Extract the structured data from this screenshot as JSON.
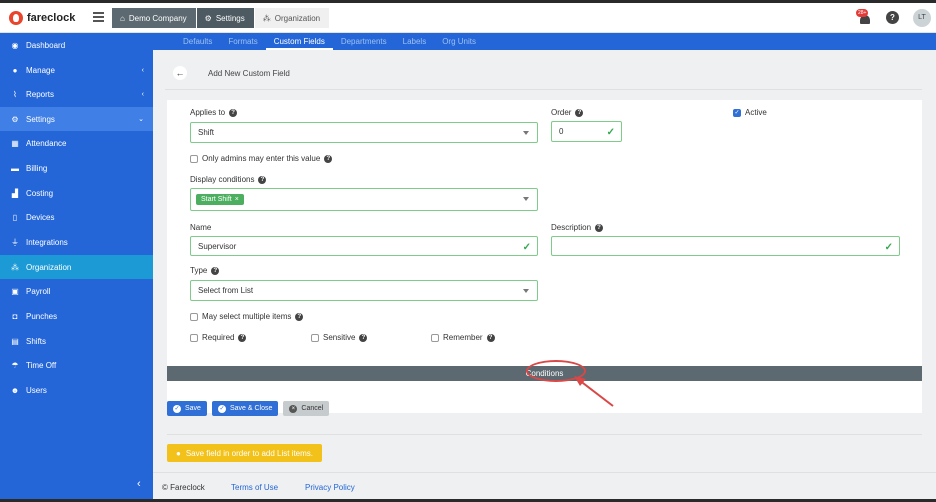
{
  "app": {
    "brand": "fareclock"
  },
  "breadcrumbs": [
    {
      "label": "Demo Company",
      "icon": "home-icon"
    },
    {
      "label": "Settings",
      "icon": "gear-icon"
    },
    {
      "label": "Organization",
      "icon": "org-chart-icon"
    }
  ],
  "header": {
    "notification_count": "28+",
    "help": "?",
    "avatar_initials": "LT"
  },
  "sidebar": {
    "items": [
      {
        "label": "Dashboard",
        "icon": "dashboard-icon"
      },
      {
        "label": "Manage",
        "icon": "user-icon",
        "chevron": "‹"
      },
      {
        "label": "Reports",
        "icon": "chart-icon",
        "chevron": "‹"
      },
      {
        "label": "Settings",
        "icon": "gear-icon",
        "chevron": "⌄"
      },
      {
        "label": "Attendance",
        "icon": "calendar-icon"
      },
      {
        "label": "Billing",
        "icon": "credit-card-icon"
      },
      {
        "label": "Costing",
        "icon": "bar-chart-icon"
      },
      {
        "label": "Devices",
        "icon": "tablet-icon"
      },
      {
        "label": "Integrations",
        "icon": "plug-icon"
      },
      {
        "label": "Organization",
        "icon": "org-chart-icon"
      },
      {
        "label": "Payroll",
        "icon": "money-icon"
      },
      {
        "label": "Punches",
        "icon": "truck-icon"
      },
      {
        "label": "Shifts",
        "icon": "briefcase-icon"
      },
      {
        "label": "Time Off",
        "icon": "umbrella-icon"
      },
      {
        "label": "Users",
        "icon": "users-icon"
      }
    ],
    "collapse": "‹"
  },
  "tabs": [
    "Defaults",
    "Formats",
    "Custom Fields",
    "Departments",
    "Labels",
    "Org Units"
  ],
  "form": {
    "title": "Add New Custom Field",
    "back": "←",
    "applies_to_label": "Applies to",
    "applies_to_value": "Shift",
    "order_label": "Order",
    "order_value": "0",
    "active_label": "Active",
    "only_admins_label": "Only admins may enter this value",
    "display_conditions_label": "Display conditions",
    "display_chip": "Start Shift",
    "chip_remove": "×",
    "name_label": "Name",
    "name_value": "Supervisor",
    "description_label": "Description",
    "description_value": "",
    "type_label": "Type",
    "type_value": "Select from List",
    "multiple_label": "May select multiple items",
    "required_label": "Required",
    "sensitive_label": "Sensitive",
    "remember_label": "Remember",
    "conditions_label": "Conditions"
  },
  "actions": {
    "save": "Save",
    "save_close": "Save & Close",
    "cancel": "Cancel"
  },
  "notice": "Save field in order to add List items.",
  "footer": {
    "copyright": "© Fareclock",
    "terms": "Terms of Use",
    "privacy": "Privacy Policy"
  },
  "colors": {
    "sidebar": "#2466d8",
    "valid": "#7fcb8a",
    "chip": "#4caf60",
    "notice": "#f2c21b",
    "annotation": "#d94747"
  }
}
